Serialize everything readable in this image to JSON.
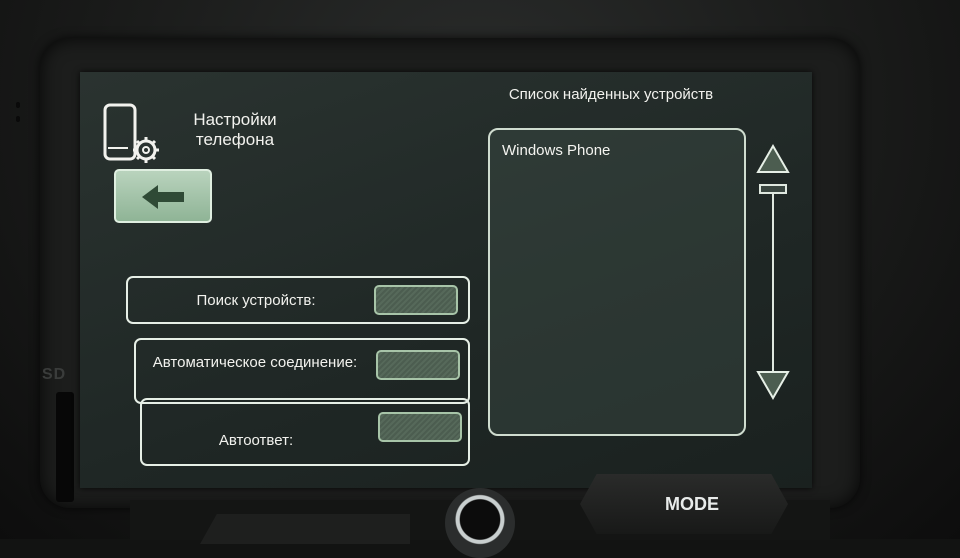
{
  "header": {
    "settings_title": "Настройки телефона",
    "list_title": "Список найденных устройств"
  },
  "icons": {
    "phone_settings": "phone-gear-icon",
    "back": "arrow-left-icon",
    "scroll_up": "triangle-up-icon",
    "scroll_down": "triangle-down-icon"
  },
  "settings": [
    {
      "label": "Поиск устройств:"
    },
    {
      "label": "Автоматическое соединение:"
    },
    {
      "label": "Автоответ:"
    }
  ],
  "devices": [
    {
      "name": "Windows Phone"
    }
  ],
  "hardware": {
    "mode_label": "MODE",
    "sd_label": "SD"
  },
  "colors": {
    "screen_bg": "#1f2725",
    "accent_green": "#8fb496",
    "outline": "#e6efe6",
    "text": "#f2f2ee"
  }
}
